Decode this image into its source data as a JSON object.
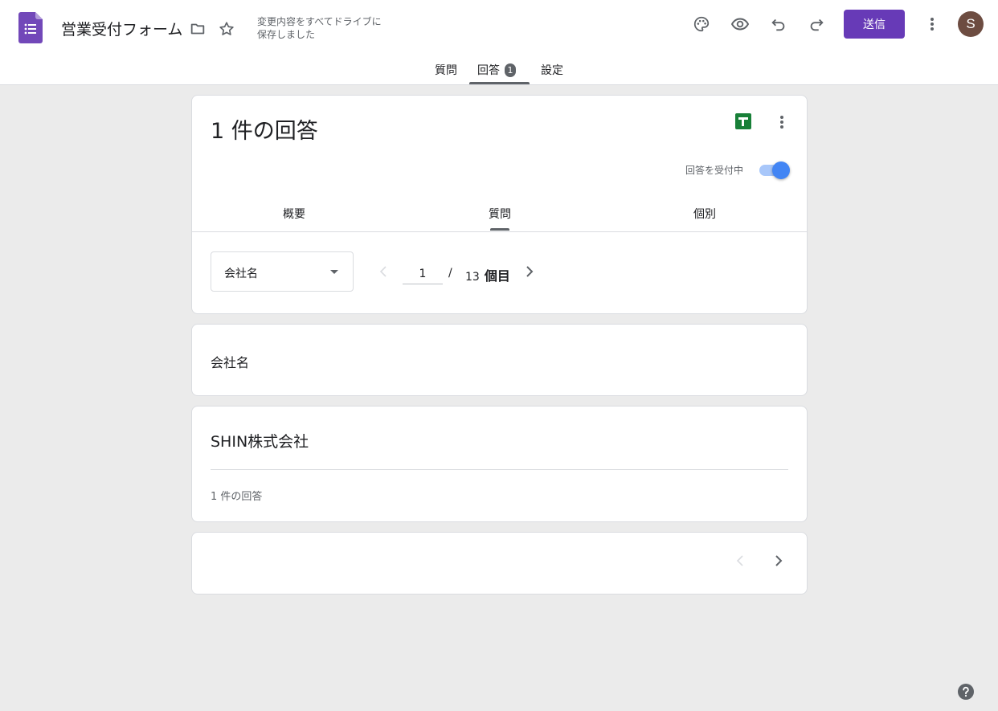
{
  "header": {
    "doc_title": "営業受付フォーム",
    "save_status_line1": "変更内容をすべてドライブに",
    "save_status_line2": "保存しました",
    "send_label": "送信",
    "avatar_initial": "S",
    "icons": [
      "forms-logo-icon",
      "folder-icon",
      "star-icon",
      "palette-icon",
      "preview-eye-icon",
      "undo-icon",
      "redo-icon",
      "more-vert-icon"
    ]
  },
  "top_tabs": {
    "questions": "質問",
    "responses": "回答",
    "responses_badge": "1",
    "settings": "設定",
    "active": "responses"
  },
  "summary_card": {
    "title": "1 件の回答",
    "accepting_label": "回答を受付中",
    "accepting_on": true,
    "sub_tabs": {
      "summary": "概要",
      "question": "質問",
      "individual": "個別",
      "active": "question"
    },
    "question_select_value": "会社名",
    "page_current": "1",
    "page_separator": "/",
    "page_total": "13",
    "page_unit": "個目"
  },
  "question_card": {
    "title": "会社名"
  },
  "answer_card": {
    "answer": "SHIN株式会社",
    "count_label": "1 件の回答"
  },
  "colors": {
    "brand_purple": "#673ab7",
    "toggle_blue": "#4285f4",
    "sheets_green": "#188038",
    "background": "#ebebeb"
  }
}
